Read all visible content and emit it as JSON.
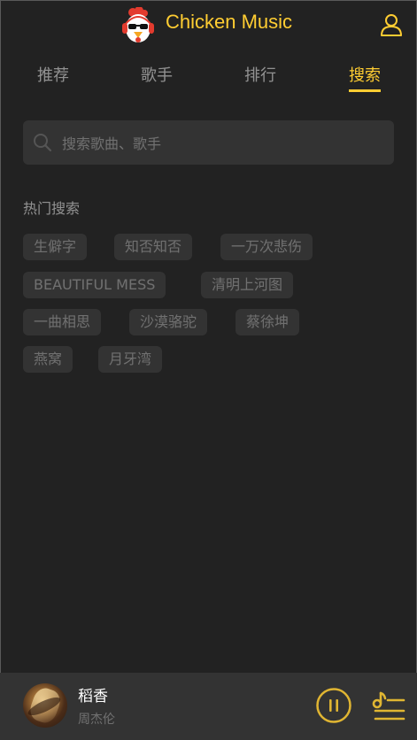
{
  "header": {
    "title": "Chicken Music",
    "logo_icon": "chicken-logo-icon",
    "user_icon": "user-icon",
    "accent_color": "#ffcd32"
  },
  "tabs": [
    {
      "label": "推荐",
      "active": false
    },
    {
      "label": "歌手",
      "active": false
    },
    {
      "label": "排行",
      "active": false
    },
    {
      "label": "搜索",
      "active": true
    }
  ],
  "search": {
    "placeholder": "搜索歌曲、歌手",
    "value": ""
  },
  "hot_search": {
    "title": "热门搜索",
    "keys": [
      "生僻字",
      "知否知否",
      "一万次悲伤",
      "BEAUTIFUL MESS",
      "清明上河图",
      "一曲相思",
      "沙漠骆驼",
      "蔡徐坤",
      "燕窝",
      "月牙湾"
    ]
  },
  "player": {
    "song_name": "稻香",
    "singer": "周杰伦",
    "state": "playing",
    "play_icon": "pause-icon",
    "playlist_icon": "playlist-icon"
  }
}
